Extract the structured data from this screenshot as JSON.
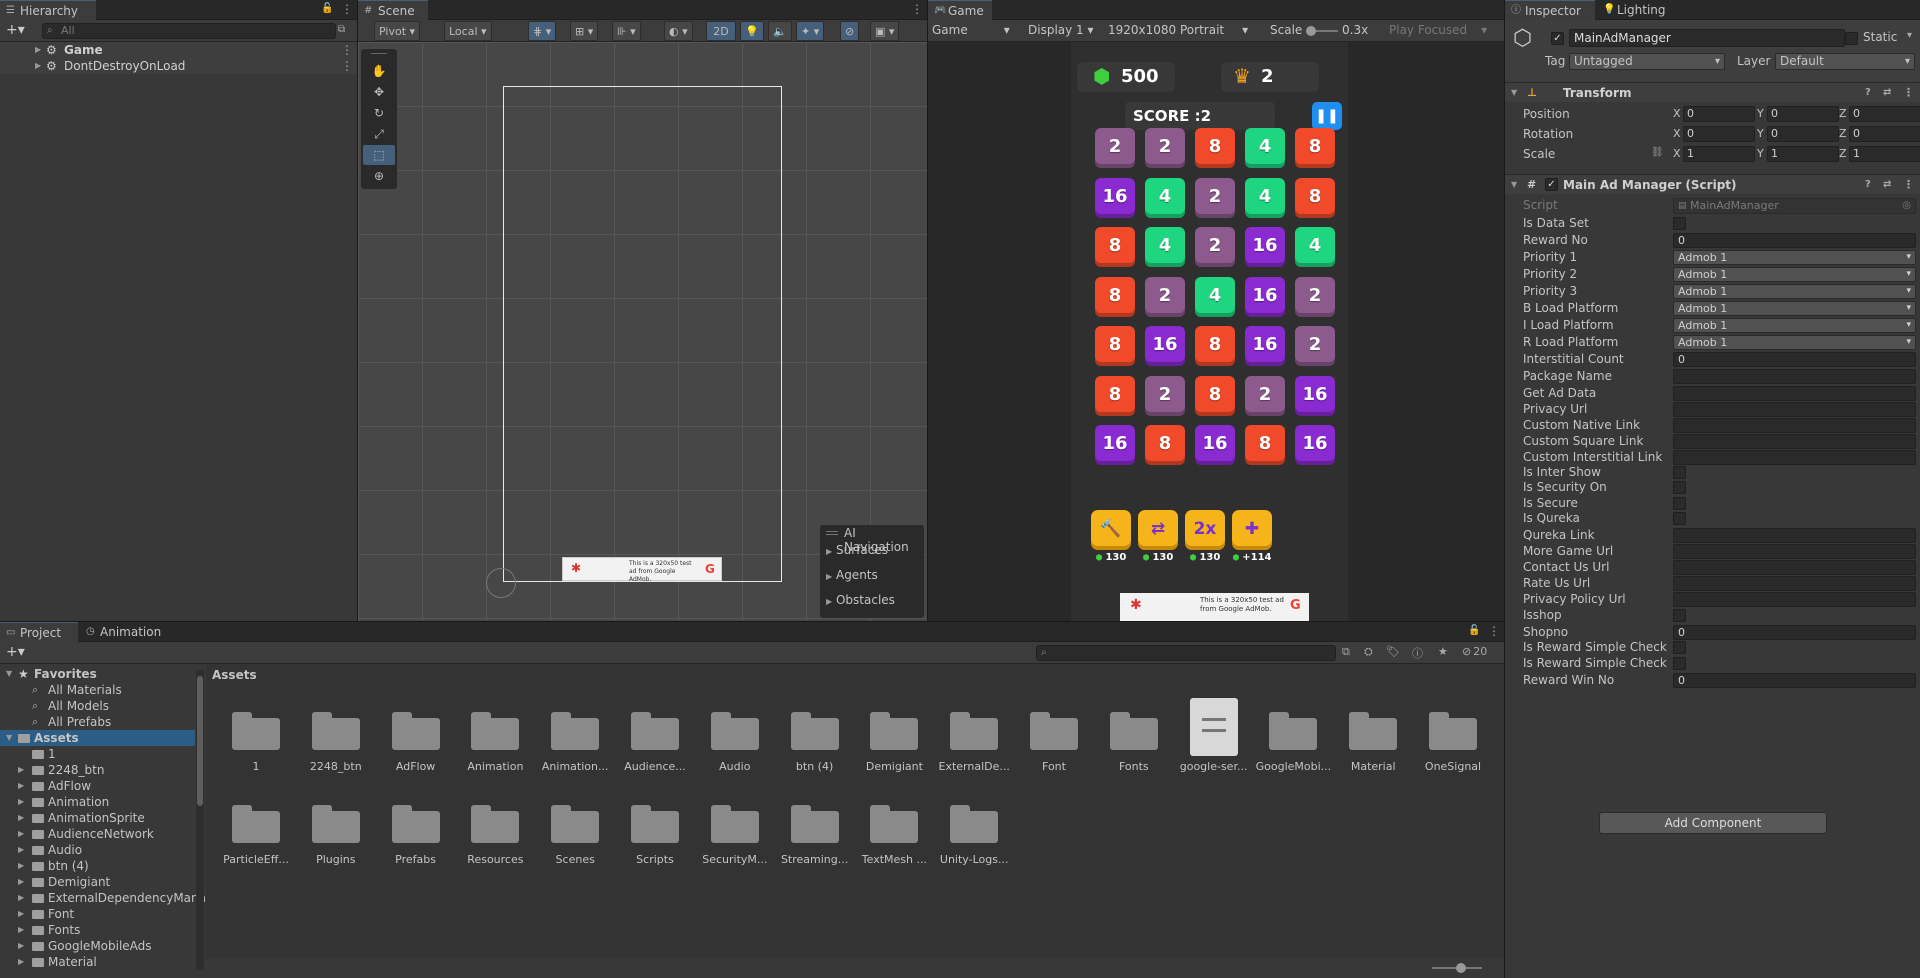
{
  "hierarchy": {
    "tab": "Hierarchy",
    "search_placeholder": "All",
    "items": [
      "Game",
      "DontDestroyOnLoad"
    ]
  },
  "scene": {
    "tab": "Scene",
    "pivot": "Pivot",
    "local": "Local",
    "mode_2d": "2D",
    "overlay_title": "AI Navigation",
    "overlay_items": [
      "Surfaces",
      "Agents",
      "Obstacles"
    ],
    "ad_text": "This is a 320x50 test ad from Google AdMob."
  },
  "game": {
    "tab": "Game",
    "mode": "Game",
    "display": "Display 1",
    "resolution": "1920x1080 Portrait",
    "scale_label": "Scale",
    "scale_value": "0.3x",
    "play_focused": "Play Focused",
    "gems": "500",
    "crowns": "2",
    "score": "SCORE :2",
    "grid": [
      [
        "2",
        "2",
        "8",
        "4",
        "8"
      ],
      [
        "16",
        "4",
        "2",
        "4",
        "8"
      ],
      [
        "8",
        "4",
        "2",
        "16",
        "4"
      ],
      [
        "8",
        "2",
        "4",
        "16",
        "2"
      ],
      [
        "8",
        "16",
        "8",
        "16",
        "2"
      ],
      [
        "8",
        "2",
        "8",
        "2",
        "16"
      ],
      [
        "16",
        "8",
        "16",
        "8",
        "16"
      ]
    ],
    "boosters": [
      "130",
      "130",
      "130",
      "+114"
    ],
    "booster_2x": "2x",
    "ad_text": "This is a 320x50 test ad from Google AdMob."
  },
  "inspector": {
    "tabs": [
      "Inspector",
      "Lighting"
    ],
    "object_name": "MainAdManager",
    "static_label": "Static",
    "tag_label": "Tag",
    "tag_value": "Untagged",
    "layer_label": "Layer",
    "layer_value": "Default",
    "transform": {
      "title": "Transform",
      "rows": [
        {
          "label": "Position",
          "x": "0",
          "y": "0",
          "z": "0"
        },
        {
          "label": "Rotation",
          "x": "0",
          "y": "0",
          "z": "0"
        },
        {
          "label": "Scale",
          "x": "1",
          "y": "1",
          "z": "1"
        }
      ]
    },
    "script": {
      "title": "Main Ad Manager (Script)",
      "script_label": "Script",
      "script_value": "MainAdManager",
      "props": [
        {
          "label": "Is Data Set",
          "type": "check"
        },
        {
          "label": "Reward No",
          "type": "text",
          "value": "0"
        },
        {
          "label": "Priority 1",
          "type": "select",
          "value": "Admob 1"
        },
        {
          "label": "Priority 2",
          "type": "select",
          "value": "Admob 1"
        },
        {
          "label": "Priority 3",
          "type": "select",
          "value": "Admob 1"
        },
        {
          "label": "B Load Platform",
          "type": "select",
          "value": "Admob 1"
        },
        {
          "label": "I Load Platform",
          "type": "select",
          "value": "Admob 1"
        },
        {
          "label": "R Load Platform",
          "type": "select",
          "value": "Admob 1"
        },
        {
          "label": "Interstitial Count",
          "type": "text",
          "value": "0"
        },
        {
          "label": "Package Name",
          "type": "text",
          "value": ""
        },
        {
          "label": "Get Ad Data",
          "type": "text",
          "value": ""
        },
        {
          "label": "Privacy Url",
          "type": "text",
          "value": ""
        },
        {
          "label": "Custom Native Link",
          "type": "text",
          "value": ""
        },
        {
          "label": "Custom Square Link",
          "type": "text",
          "value": ""
        },
        {
          "label": "Custom Interstitial Link",
          "type": "text",
          "value": ""
        },
        {
          "label": "Is Inter Show",
          "type": "check"
        },
        {
          "label": "Is Security On",
          "type": "check"
        },
        {
          "label": "Is Secure",
          "type": "check"
        },
        {
          "label": "Is Qureka",
          "type": "check"
        },
        {
          "label": "Qureka Link",
          "type": "text",
          "value": ""
        },
        {
          "label": "More Game Url",
          "type": "text",
          "value": ""
        },
        {
          "label": "Contact Us Url",
          "type": "text",
          "value": ""
        },
        {
          "label": "Rate Us Url",
          "type": "text",
          "value": ""
        },
        {
          "label": "Privacy Policy Url",
          "type": "text",
          "value": ""
        },
        {
          "label": "Isshop",
          "type": "check"
        },
        {
          "label": "Shopno",
          "type": "text",
          "value": "0"
        },
        {
          "label": "Is Reward Simple Check",
          "type": "check"
        },
        {
          "label": "Is Reward Simple Check W",
          "type": "check"
        },
        {
          "label": "Reward Win No",
          "type": "text",
          "value": "0"
        }
      ]
    },
    "add_component": "Add Component"
  },
  "project": {
    "tabs": [
      "Project",
      "Animation"
    ],
    "favorites_label": "Favorites",
    "favorites": [
      "All Materials",
      "All Models",
      "All Prefabs"
    ],
    "assets_label": "Assets",
    "tree": [
      "1",
      "2248_btn",
      "AdFlow",
      "Animation",
      "AnimationSprite",
      "AudienceNetwork",
      "Audio",
      "btn (4)",
      "Demigiant",
      "ExternalDependencyMana",
      "Font",
      "Fonts",
      "GoogleMobileAds",
      "Material"
    ],
    "breadcrumb": "Assets",
    "hidden_count": "20",
    "grid_row1": [
      "1",
      "2248_btn",
      "AdFlow",
      "Animation",
      "Animation...",
      "Audience...",
      "Audio",
      "btn (4)",
      "Demigiant",
      "ExternalDe...",
      "Font",
      "Fonts",
      "google-ser...",
      "GoogleMobi...",
      "Material",
      "OneSignal"
    ],
    "grid_row2": [
      "ParticleEff...",
      "Plugins",
      "Prefabs",
      "Resources",
      "Scenes",
      "Scripts",
      "SecurityM...",
      "Streaming...",
      "TextMesh ...",
      "Unity-Logs..."
    ]
  }
}
